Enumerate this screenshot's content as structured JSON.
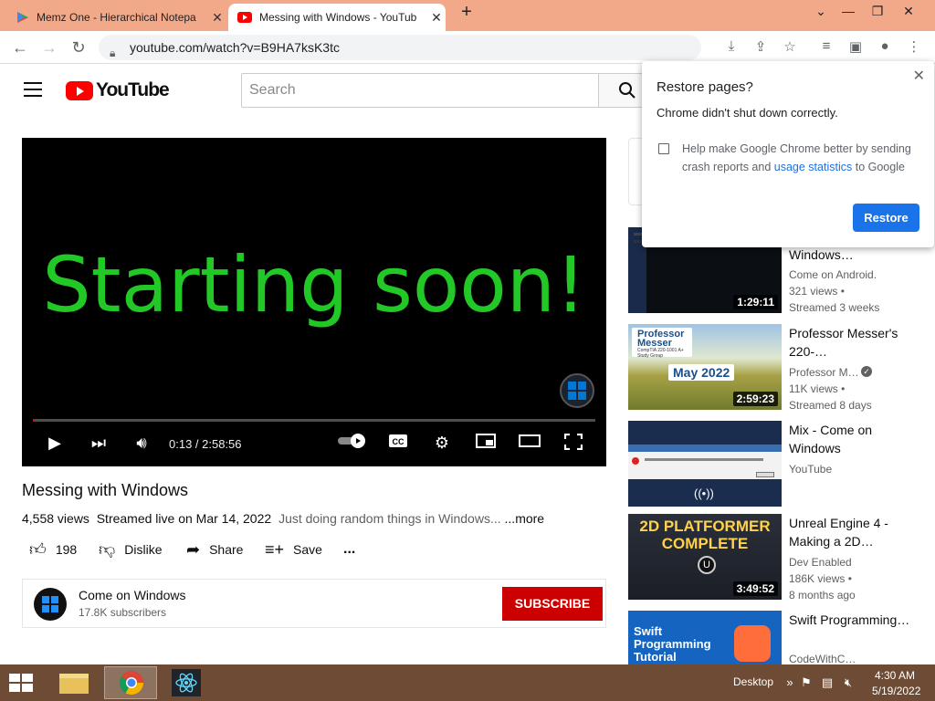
{
  "browser": {
    "tabs": [
      {
        "title": "Memz One - Hierarchical Notepa",
        "icon": "play-store-icon"
      },
      {
        "title": "Messing with Windows - YouTub",
        "icon": "youtube-icon"
      }
    ],
    "url": "youtube.com/watch?v=B9HA7ksK3tc",
    "new_tab": "+"
  },
  "youtube": {
    "logo_text": "YouTube",
    "search_placeholder": "Search"
  },
  "player": {
    "overlay_text": "Starting soon!",
    "time": "0:13 / 2:58:56",
    "progress_fraction": 0.0012
  },
  "video": {
    "title": "Messing with Windows",
    "views": "4,558 views",
    "streamed": "Streamed live on Mar 14, 2022",
    "description": "Just doing random things in Windows...",
    "more": "...more",
    "likes": "198",
    "dislike_label": "Dislike",
    "share_label": "Share",
    "save_label": "Save",
    "more_actions": "..."
  },
  "channel": {
    "name": "Come on Windows",
    "subscribers": "17.8K subscribers",
    "subscribe_label": "SUBSCRIBE"
  },
  "recommendations": [
    {
      "title": "Windows…",
      "channel": "Come on Android.",
      "views": "321 views •",
      "age": "Streamed 3 weeks",
      "duration": "1:29:11"
    },
    {
      "title": "Professor Messer's 220-…",
      "channel": "Professor M…",
      "views": "11K views •",
      "age": "Streamed 8 days",
      "duration": "2:59:23",
      "thumb_brand": "Professor Messer",
      "thumb_sub": "CompTIA 220-1001 A+ Study Group",
      "thumb_month": "May 2022"
    },
    {
      "title": "Mix - Come on Windows",
      "channel": "YouTube",
      "views": "",
      "age": "",
      "duration": ""
    },
    {
      "title": "Unreal Engine 4 - Making a 2D…",
      "channel": "Dev Enabled",
      "views": "186K views •",
      "age": "8 months ago",
      "duration": "3:49:52",
      "thumb_text": "2D PLATFORMER COMPLETE"
    },
    {
      "title": "Swift Programming…",
      "channel": "CodeWithC…",
      "views": "",
      "age": "",
      "duration": "",
      "thumb_text": "Swift Programming Tutorial"
    }
  ],
  "restore_dialog": {
    "title": "Restore pages?",
    "message": "Chrome didn't shut down correctly.",
    "crash_text_1": "Help make Google Chrome better by sending crash reports and",
    "crash_link": "usage statistics",
    "crash_text_2": "to Google",
    "restore_label": "Restore"
  },
  "taskbar": {
    "desktop_label": "Desktop",
    "time": "4:30 AM",
    "date": "5/19/2022"
  },
  "colors": {
    "tab_strip": "#f2a98a",
    "yt_red": "#ff0000",
    "video_text": "#22c825",
    "subscribe": "#cc0000",
    "chrome_blue": "#1a73e8",
    "taskbar": "#6e4b34"
  }
}
